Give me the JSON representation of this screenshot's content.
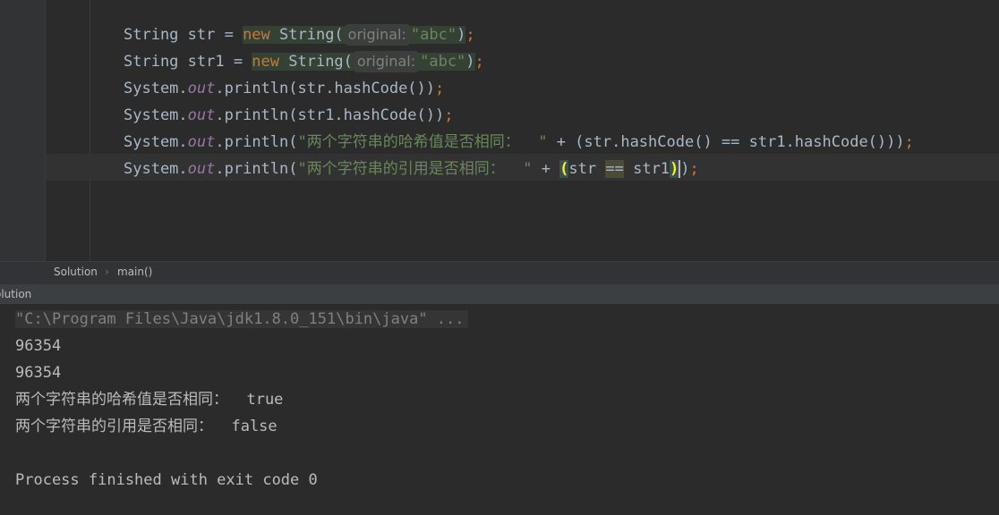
{
  "editor": {
    "lines": [
      {
        "t1": "String str = ",
        "kw": "new",
        "t2": " String(",
        "hint": "original:",
        "str": "\"abc\"",
        "t3": ")",
        "semi": ";"
      },
      {
        "t1": "String str1 = ",
        "kw": "new",
        "t2": " String(",
        "hint": "original:",
        "str": "\"abc\"",
        "t3": ")",
        "semi": ";"
      },
      {
        "t1": "System.",
        "field": "out",
        "t2": ".println(str.hashCode())",
        "semi": ";"
      },
      {
        "t1": "System.",
        "field": "out",
        "t2": ".println(str1.hashCode())",
        "semi": ";"
      },
      {
        "t1": "System.",
        "field": "out",
        "t2": ".println(",
        "str": "\"两个字符串的哈希值是否相同：  \"",
        "t3": " + (str.hashCode() == str1.hashCode()))",
        "semi": ";"
      },
      {
        "t1": "System.",
        "field": "out",
        "t2": ".println(",
        "str": "\"两个字符串的引用是否相同：  \"",
        "t3": " + ",
        "p_open": "(",
        "t4": "str ",
        "op": "==",
        "t5": " str1",
        "p_close": ")",
        "t6": ")",
        "semi": ";"
      }
    ]
  },
  "breadcrumb": {
    "items": [
      "Solution",
      "main()"
    ],
    "separator": "›"
  },
  "run_panel": {
    "title": "olution",
    "command": "\"C:\\Program Files\\Java\\jdk1.8.0_151\\bin\\java\" ...",
    "output": [
      "96354",
      "96354",
      "两个字符串的哈希值是否相同：  true",
      "两个字符串的引用是否相同：  false",
      "",
      "Process finished with exit code 0"
    ]
  },
  "colors": {
    "background": "#2b2b2b",
    "keyword": "#cc7832",
    "string": "#6a8759",
    "static_field": "#9876aa",
    "default_text": "#a9b7c6",
    "matched_paren": "#ffef28"
  }
}
